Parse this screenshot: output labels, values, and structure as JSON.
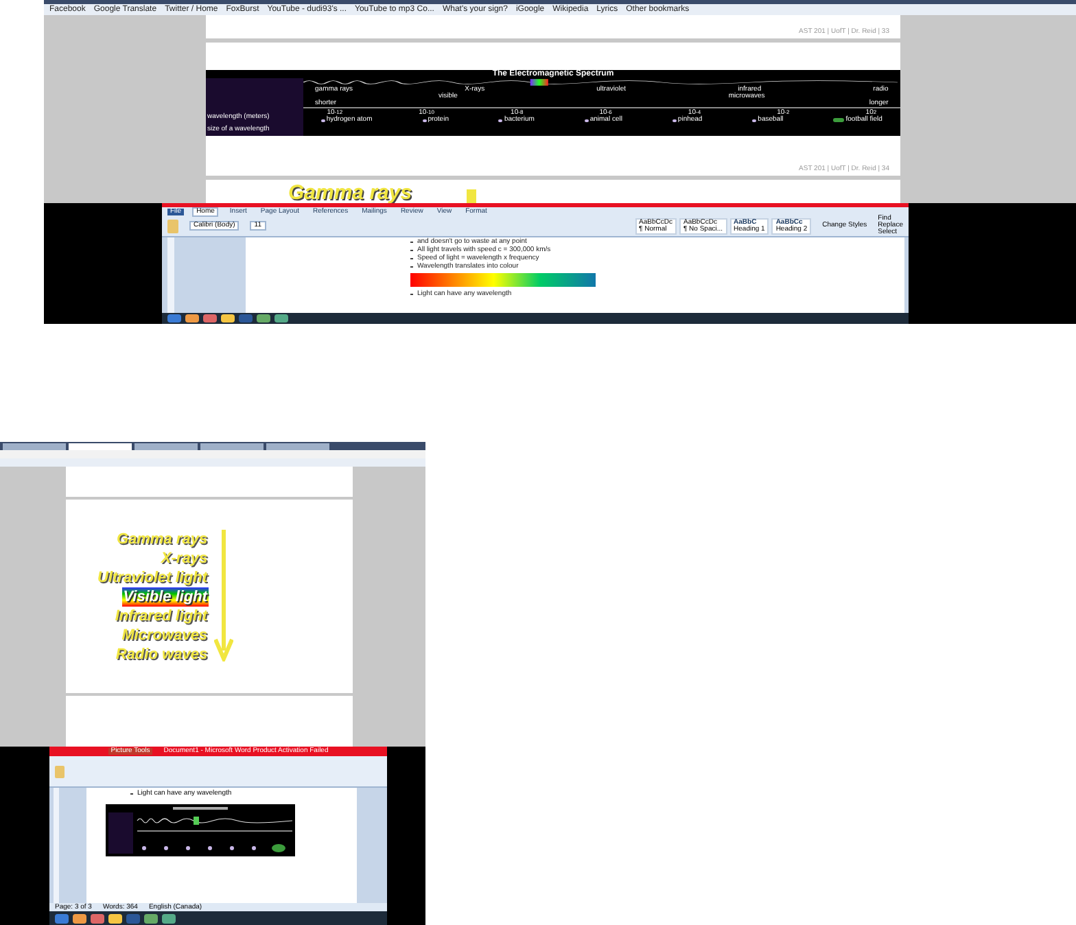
{
  "top_capture": {
    "bookmarks": [
      "Facebook",
      "Google Translate",
      "Twitter / Home",
      "FoxBurst",
      "YouTube - dudi93's ...",
      "YouTube to mp3 Co...",
      "What's your sign?",
      "iGoogle",
      "Wikipedia",
      "Lyrics",
      "Other bookmarks"
    ],
    "page_footer": "AST 201 | UofT | Dr. Reid | 33",
    "spectrum": {
      "title": "The Electromagnetic Spectrum",
      "bands": [
        "gamma rays",
        "X-rays",
        "ultraviolet",
        "infrared",
        "radio"
      ],
      "visible": "visible",
      "microwaves": "microwaves",
      "wavelength_label": "wavelength (meters)",
      "shorter": "shorter",
      "longer": "longer",
      "ticks": [
        "10$^{-12}$",
        "10$^{-10}$",
        "10$^{-8}$",
        "10$^{-6}$",
        "10$^{-4}$",
        "10$^{-2}$",
        "10$^{2}$"
      ],
      "size_label": "size of a wavelength",
      "objects": [
        "hydrogen atom",
        "protein",
        "bacterium",
        "animal cell",
        "pinhead",
        "baseball",
        "football field"
      ]
    },
    "page_footer_2": "AST 201 | UofT | Dr. Reid | 34",
    "heading": "Gamma rays",
    "word": {
      "tabs": [
        {
          "label": "File",
          "selected": false
        },
        {
          "label": "Home",
          "selected": true
        },
        {
          "label": "Insert",
          "selected": false
        },
        {
          "label": "Page Layout",
          "selected": false
        },
        {
          "label": "References",
          "selected": false
        },
        {
          "label": "Mailings",
          "selected": false
        },
        {
          "label": "Review",
          "selected": false
        },
        {
          "label": "View",
          "selected": false
        },
        {
          "label": "Format",
          "selected": false
        }
      ],
      "font": "Calibri (Body)",
      "size": "11",
      "styles": [
        {
          "sample": "AaBbCcDc",
          "name": "¶ Normal"
        },
        {
          "sample": "AaBbCcDc",
          "name": "¶ No Spaci..."
        },
        {
          "sample": "AaBbC",
          "name": "Heading 1"
        },
        {
          "sample": "AaBbCc",
          "name": "Heading 2"
        }
      ],
      "change_styles": "Change Styles",
      "editing": [
        "Find",
        "Replace",
        "Select"
      ],
      "lines": [
        "and doesn't go to waste at any point",
        "All light travels with speed c = 300,000 km/s",
        "Speed of light = wavelength x frequency",
        "Wavelength translates into colour"
      ],
      "last_line": "Light can have any wavelength"
    }
  },
  "bottom_capture": {
    "tabs": [
      {
        "selected": false
      },
      {
        "selected": true
      },
      {
        "selected": false
      },
      {
        "selected": false
      },
      {
        "selected": false
      }
    ],
    "arrow_list": [
      {
        "label": "Gamma rays",
        "highlighted": false
      },
      {
        "label": "X-rays",
        "highlighted": false
      },
      {
        "label": "Ultraviolet light",
        "highlighted": false
      },
      {
        "label": "Visible light",
        "highlighted": true
      },
      {
        "label": "Infrared light",
        "highlighted": false
      },
      {
        "label": "Microwaves",
        "highlighted": false
      },
      {
        "label": "Radio waves",
        "highlighted": false
      }
    ],
    "word": {
      "title": "Document1 - Microsoft Word Product Activation Failed",
      "picture_tools": "Picture Tools",
      "first_line": "Light can have any wavelength",
      "status": [
        "Page: 3 of 3",
        "Words: 364",
        "English (Canada)"
      ]
    }
  }
}
